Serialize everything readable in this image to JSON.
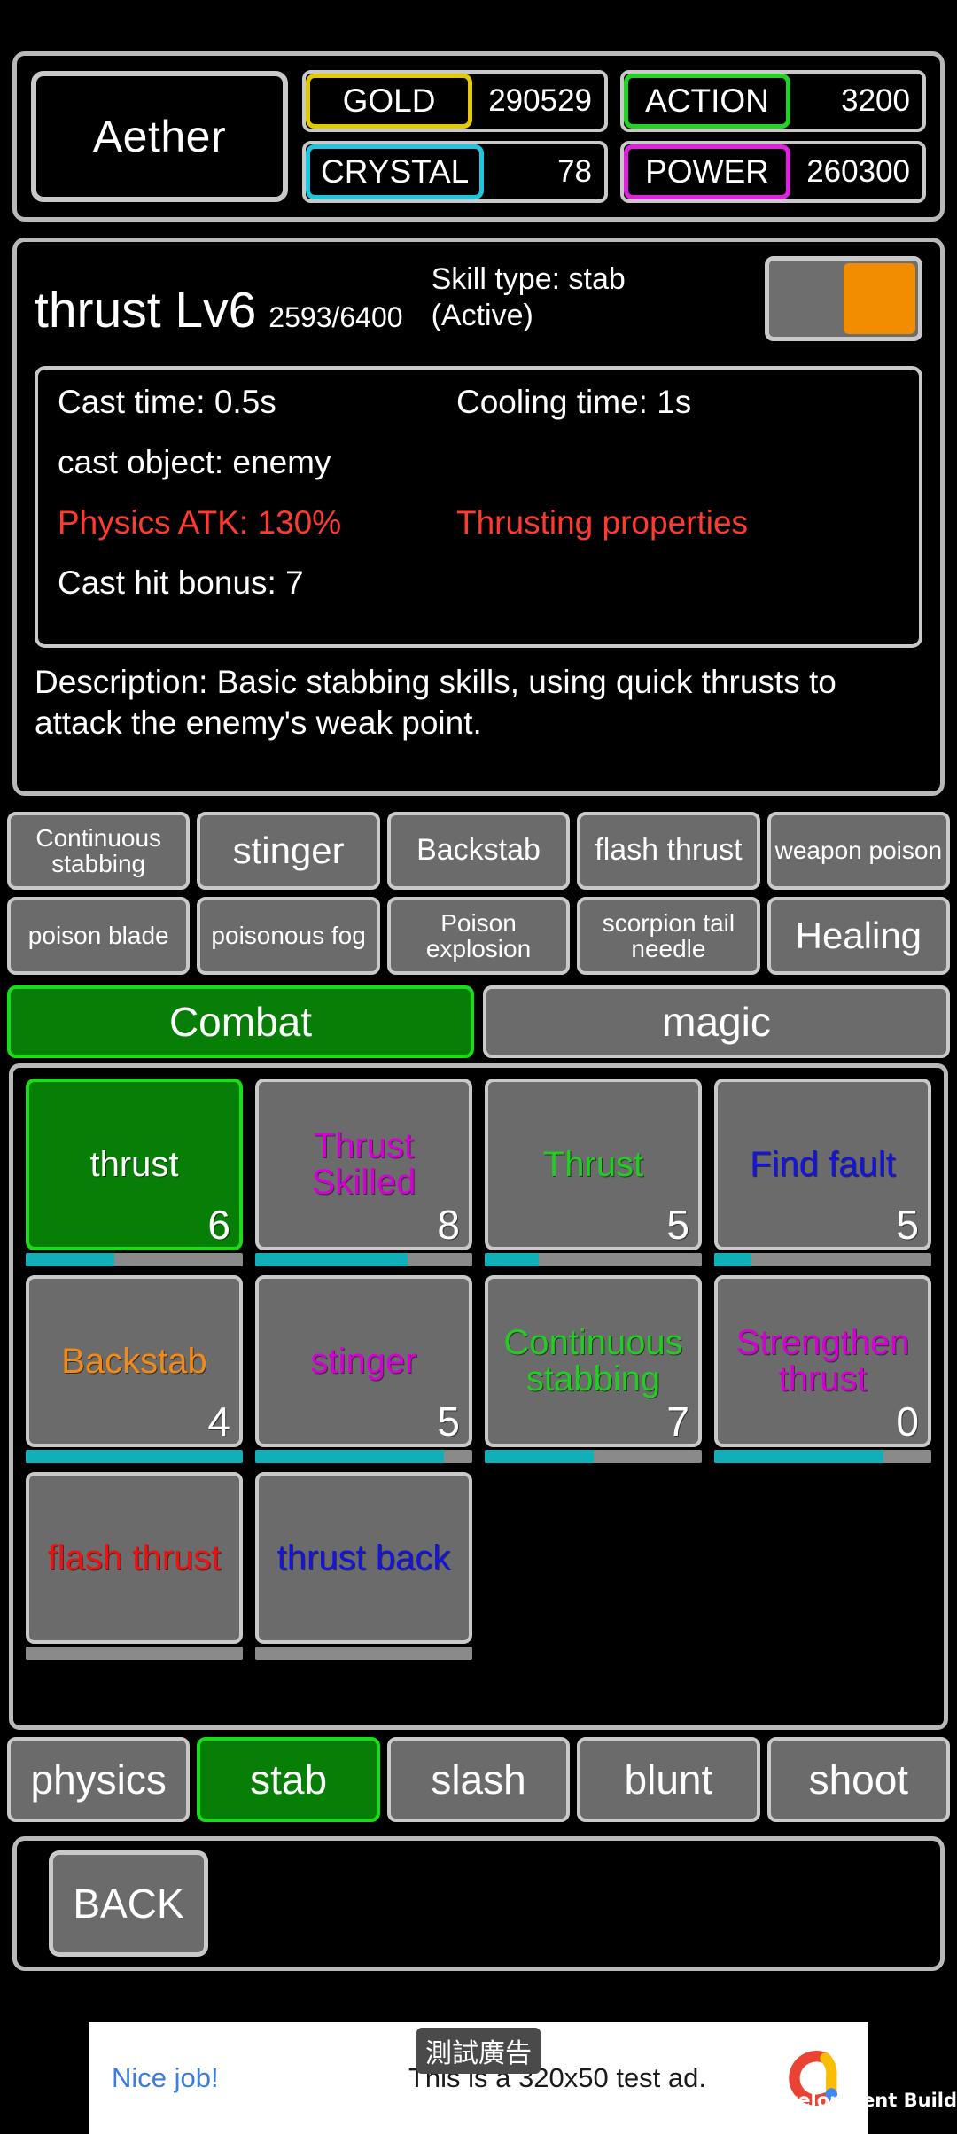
{
  "header": {
    "player_name": "Aether",
    "stats": [
      {
        "label": "GOLD",
        "value": "290529",
        "color": "#e2c900"
      },
      {
        "label": "ACTION",
        "value": "3200",
        "color": "#21d421"
      },
      {
        "label": "CRYSTAL",
        "value": "78",
        "color": "#1fc6e0"
      },
      {
        "label": "POWER",
        "value": "260300",
        "color": "#e021e0"
      }
    ]
  },
  "detail": {
    "skill_name": "thrust Lv6",
    "experience": "2593/6400",
    "skill_type": "Skill type: stab",
    "skill_state": "(Active)",
    "toggle_on": true,
    "stats": [
      {
        "left": "Cast time: 0.5s",
        "right": "Cooling time: 1s",
        "red": false
      },
      {
        "left": "cast object: enemy",
        "right": "",
        "red": false
      },
      {
        "left": "Physics ATK: 130%",
        "right": "Thrusting properties",
        "red": true
      },
      {
        "left": "Cast hit bonus: 7",
        "right": "",
        "red": false
      }
    ],
    "description": "Description: Basic stabbing skills, using quick thrusts to attack the enemy's weak point."
  },
  "chip_rows": [
    [
      {
        "label": "Continuous stabbing",
        "size": "s-sm"
      },
      {
        "label": "stinger",
        "size": "s-big"
      },
      {
        "label": "Backstab",
        "size": "s-med"
      },
      {
        "label": "flash thrust",
        "size": "s-med"
      },
      {
        "label": "weapon poison",
        "size": "s-sm"
      }
    ],
    [
      {
        "label": "poison blade",
        "size": "s-sm"
      },
      {
        "label": "poisonous fog",
        "size": "s-sm"
      },
      {
        "label": "Poison explosion",
        "size": "s-sm"
      },
      {
        "label": "scorpion tail needle",
        "size": "s-sm"
      },
      {
        "label": "Healing",
        "size": "s-big"
      }
    ]
  ],
  "tabs": [
    {
      "label": "Combat",
      "active": true
    },
    {
      "label": "magic",
      "active": false
    }
  ],
  "grid": [
    {
      "label": "thrust",
      "level": "6",
      "color": "#ffffff",
      "progress": 41,
      "selected": true
    },
    {
      "label": "Thrust Skilled",
      "level": "8",
      "color": "#d400d4",
      "progress": 70,
      "selected": false
    },
    {
      "label": "Thrust",
      "level": "5",
      "color": "#22cc22",
      "progress": 25,
      "selected": false
    },
    {
      "label": "Find fault",
      "level": "5",
      "color": "#1414dd",
      "progress": 17,
      "selected": false
    },
    {
      "label": "Backstab",
      "level": "4",
      "color": "#f08a18",
      "progress": 100,
      "selected": false
    },
    {
      "label": "stinger",
      "level": "5",
      "color": "#d400d4",
      "progress": 87,
      "selected": false
    },
    {
      "label": "Continuous stabbing",
      "level": "7",
      "color": "#22cc22",
      "progress": 50,
      "selected": false
    },
    {
      "label": "Strengthen thrust",
      "level": "0",
      "color": "#d400d4",
      "progress": 78,
      "selected": false
    },
    {
      "label": "flash thrust",
      "level": "",
      "color": "#ee1111",
      "progress": 0,
      "selected": false
    },
    {
      "label": "thrust back",
      "level": "",
      "color": "#1414dd",
      "progress": 0,
      "selected": false
    }
  ],
  "filters": [
    {
      "label": "physics",
      "active": false
    },
    {
      "label": "stab",
      "active": true
    },
    {
      "label": "slash",
      "active": false
    },
    {
      "label": "blunt",
      "active": false
    },
    {
      "label": "shoot",
      "active": false
    }
  ],
  "back_button": "BACK",
  "ad": {
    "badge": "測試廣告",
    "cta": "Nice job!",
    "text": "This is a 320x50 test ad."
  },
  "watermark": "Development Build"
}
